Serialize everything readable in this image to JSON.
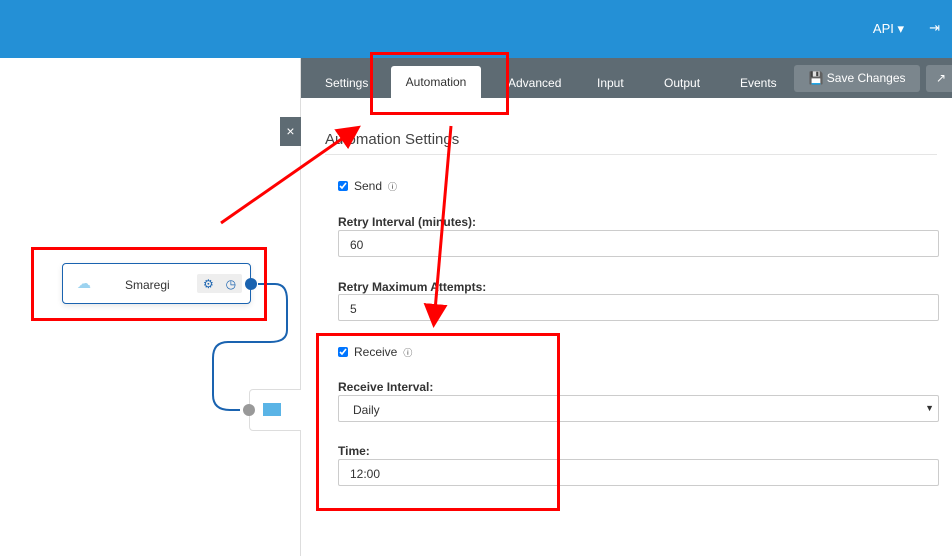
{
  "header": {
    "api_label": "API ▾",
    "logout_icon": "sign-out-icon"
  },
  "canvas": {
    "node_label": "Smaregi",
    "close_label": "×"
  },
  "tabs": [
    {
      "label": "Settings"
    },
    {
      "label": "Automation"
    },
    {
      "label": "Advanced"
    },
    {
      "label": "Input"
    },
    {
      "label": "Output"
    },
    {
      "label": "Events"
    }
  ],
  "toolbar": {
    "save_label": "💾 Save Changes"
  },
  "form": {
    "title": "Automation Settings",
    "send_label": "Send",
    "retry_interval_label": "Retry Interval (minutes):",
    "retry_interval_value": "60",
    "retry_max_label": "Retry Maximum Attempts:",
    "retry_max_value": "5",
    "receive_label": "Receive",
    "receive_interval_label": "Receive Interval:",
    "receive_interval_value": "Daily",
    "time_label": "Time:",
    "time_value": "12:00"
  },
  "colors": {
    "header": "#2490d6",
    "annotation": "#ff0000",
    "node_border": "#1a63b0"
  }
}
